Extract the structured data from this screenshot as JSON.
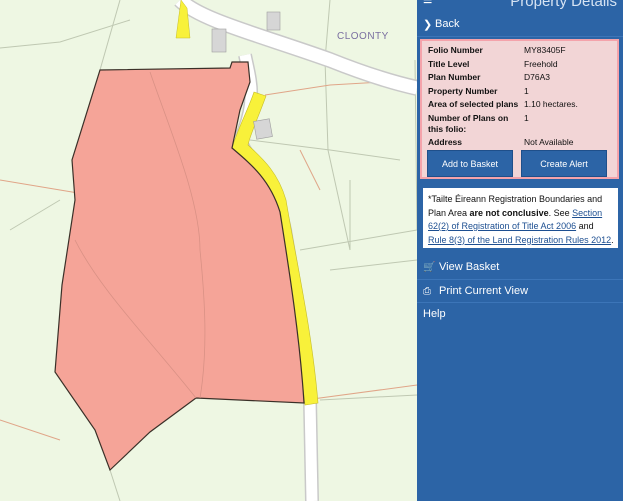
{
  "map": {
    "place_label": "CLOONTY"
  },
  "panel": {
    "title": "Property Details",
    "back_label": "Back",
    "folio": {
      "rows": [
        {
          "label": "Folio Number",
          "value": "MY83405F"
        },
        {
          "label": "Title Level",
          "value": "Freehold"
        },
        {
          "label": "Plan Number",
          "value": "D76A3"
        },
        {
          "label": "Property Number",
          "value": "1"
        },
        {
          "label": "Area of selected plans",
          "value": "1.10 hectares."
        },
        {
          "label": "Number of Plans on this folio:",
          "value": "1"
        },
        {
          "label": "Address",
          "value": "Not Available"
        }
      ],
      "add_basket_label": "Add to Basket",
      "create_alert_label": "Create Alert"
    },
    "notice": {
      "prefix": "*Tailte Éireann Registration Boundaries and Plan Area",
      "bold": "are not conclusive",
      "mid1": ". See",
      "link1": "Section 62(2) of Registration of Title Act 2006",
      "mid2": "and",
      "link2": "Rule 8(3) of the Land Registration Rules 2012",
      "suffix": "."
    },
    "menu": {
      "view_basket_label": "View Basket",
      "print_label": "Print Current View",
      "help_label": "Help"
    }
  }
}
